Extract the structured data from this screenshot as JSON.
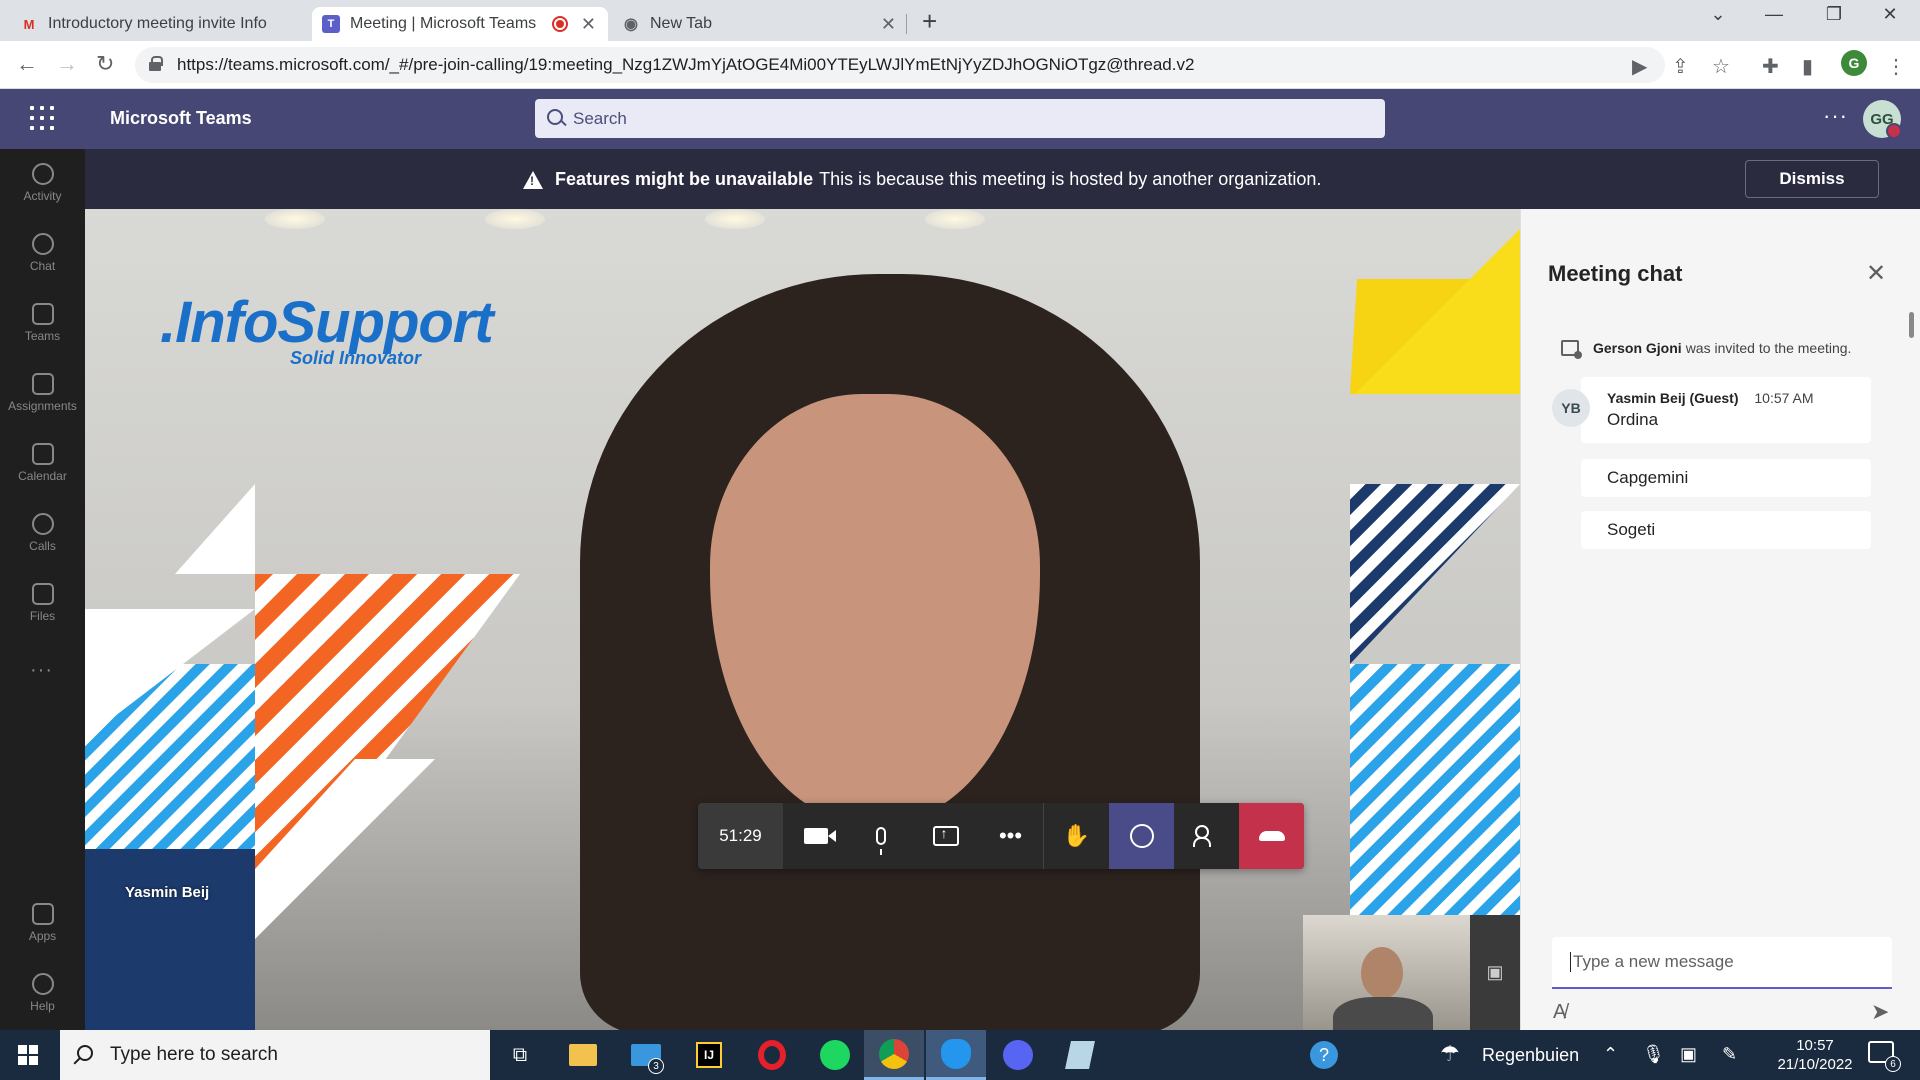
{
  "browser": {
    "tabs": [
      {
        "title": "Introductory meeting invite Info",
        "favicon": "gmail-icon",
        "active": false
      },
      {
        "title": "Meeting | Microsoft Teams",
        "favicon": "teams-icon",
        "active": true,
        "recording": true
      },
      {
        "title": "New Tab",
        "favicon": "chrome-icon",
        "active": false
      }
    ],
    "url": "https://teams.microsoft.com/_#/pre-join-calling/19:meeting_Nzg1ZWJmYjAtOGE4Mi00YTEyLWJlYmEtNjYyZDJhOGNiOTgz@thread.v2",
    "profile_initial": "G"
  },
  "teams": {
    "app_title": "Microsoft Teams",
    "search_placeholder": "Search",
    "user_initials": "GG",
    "rail": [
      {
        "label": "Activity",
        "icon": "bell-icon"
      },
      {
        "label": "Chat",
        "icon": "chat-icon"
      },
      {
        "label": "Teams",
        "icon": "teams-icon"
      },
      {
        "label": "Assignments",
        "icon": "assignments-icon"
      },
      {
        "label": "Calendar",
        "icon": "calendar-icon"
      },
      {
        "label": "Calls",
        "icon": "phone-icon"
      },
      {
        "label": "Files",
        "icon": "file-icon"
      }
    ],
    "rail_bottom": [
      {
        "label": "Apps",
        "icon": "apps-icon"
      },
      {
        "label": "Help",
        "icon": "help-icon"
      }
    ]
  },
  "banner": {
    "bold": "Features might be unavailable",
    "text": "This is because this meeting is hosted by another organization.",
    "dismiss": "Dismiss"
  },
  "stage": {
    "logo_text": ".InfoSupport",
    "logo_tagline": "Solid Innovator",
    "participant_name": "Yasmin Beij",
    "call_timer": "51:29"
  },
  "chat": {
    "title": "Meeting chat",
    "system_message": {
      "name": "Gerson Gjoni",
      "text": "was invited to the meeting."
    },
    "message": {
      "avatar": "YB",
      "author": "Yasmin Beij (Guest)",
      "time": "10:57 AM",
      "lines": [
        "Ordina",
        "Capgemini",
        "Sogeti"
      ]
    },
    "compose_placeholder": "Type a new message"
  },
  "taskbar": {
    "search_placeholder": "Type here to search",
    "mail_badge": "3",
    "weather": "Regenbuien",
    "time": "10:57",
    "date": "21/10/2022",
    "notifications": "6"
  },
  "colors": {
    "teams_header": "#464775",
    "banner": "#2b2b40",
    "hangup": "#c4314b",
    "accent": "#5b5fc7"
  }
}
